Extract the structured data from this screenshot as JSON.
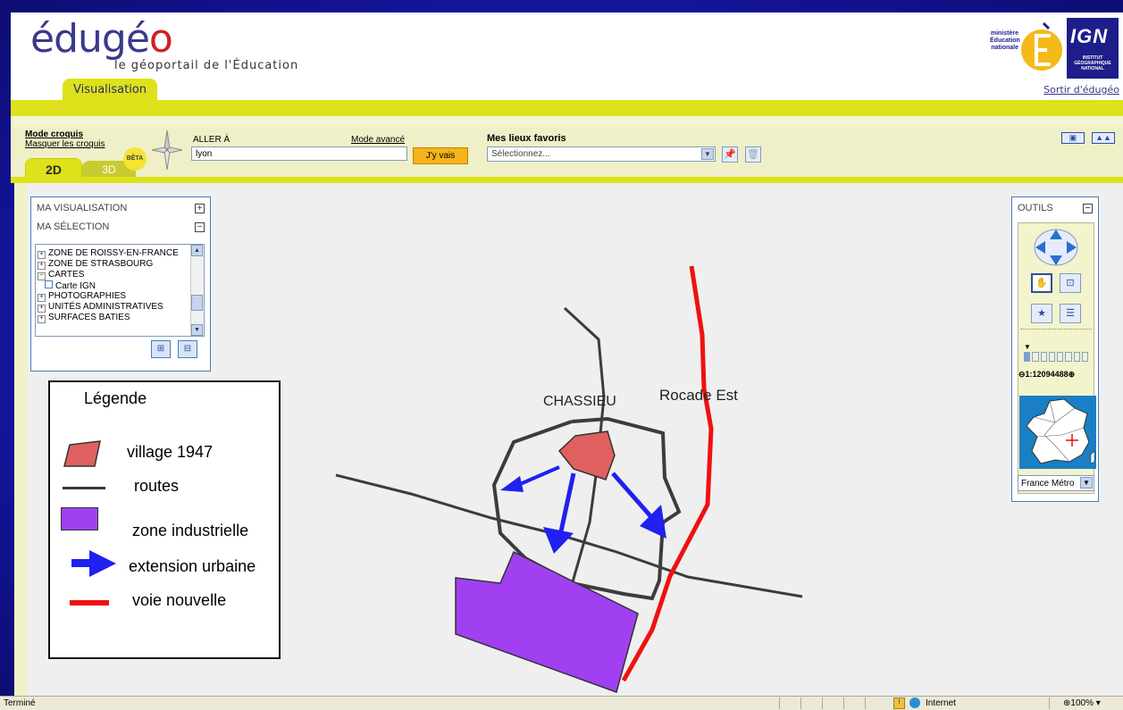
{
  "header": {
    "logo_main": "édugé",
    "logo_o": "o",
    "tagline": "le géoportail de l'Éducation",
    "tab_visualisation": "Visualisation",
    "sortir": "Sortir d'édugéo",
    "ministry_lines": [
      "ministère",
      "Éducation",
      "nationale"
    ],
    "ign_lines": [
      "INSTITUT",
      "GÉOGRAPHIQUE",
      "NATIONAL"
    ],
    "ign_logo": "IGN"
  },
  "toolbar": {
    "mode_croquis": "Mode croquis",
    "masquer_croquis": "Masquer les croquis",
    "tab_2d": "2D",
    "tab_3d": "3D",
    "beta": "BÊTA",
    "aller_label": "ALLER À",
    "mode_avance": "Mode avancé",
    "aller_value": "lyon",
    "jyvais": "J'y vais",
    "favoris_label": "Mes lieux favoris",
    "favoris_placeholder": "Sélectionnez..."
  },
  "selection_panel": {
    "ma_visualisation": "MA VISUALISATION",
    "ma_selection": "MA SÉLECTION",
    "tree": [
      {
        "label": "ZONE DE ROISSY-EN-FRANCE",
        "sign": "+",
        "child": false
      },
      {
        "label": "ZONE DE STRASBOURG",
        "sign": "+",
        "child": false
      },
      {
        "label": "CARTES",
        "sign": "−",
        "child": false
      },
      {
        "label": "Carte IGN",
        "sign": "",
        "child": true
      },
      {
        "label": "PHOTOGRAPHIES",
        "sign": "+",
        "child": false
      },
      {
        "label": "UNITÉS ADMINISTRATIVES",
        "sign": "+",
        "child": false
      },
      {
        "label": "SURFACES BATIES",
        "sign": "+",
        "child": false
      }
    ]
  },
  "legend": {
    "title": "Légende",
    "items": [
      {
        "label": "village 1947",
        "color": "#e06060"
      },
      {
        "label": "routes",
        "color": "#3a3a3a"
      },
      {
        "label": "zone industrielle",
        "color": "#a040f0"
      },
      {
        "label": "extension urbaine",
        "color": "#2020f0"
      },
      {
        "label": "voie nouvelle",
        "color": "#f01010"
      }
    ]
  },
  "map_labels": {
    "chassieu": "CHASSIEU",
    "rocade": "Rocade Est"
  },
  "tools": {
    "title": "OUTILS",
    "scale": "1:12094488",
    "region": "France Métro"
  },
  "status": {
    "text": "Terminé",
    "zone": "Internet",
    "zoom": "100%"
  }
}
